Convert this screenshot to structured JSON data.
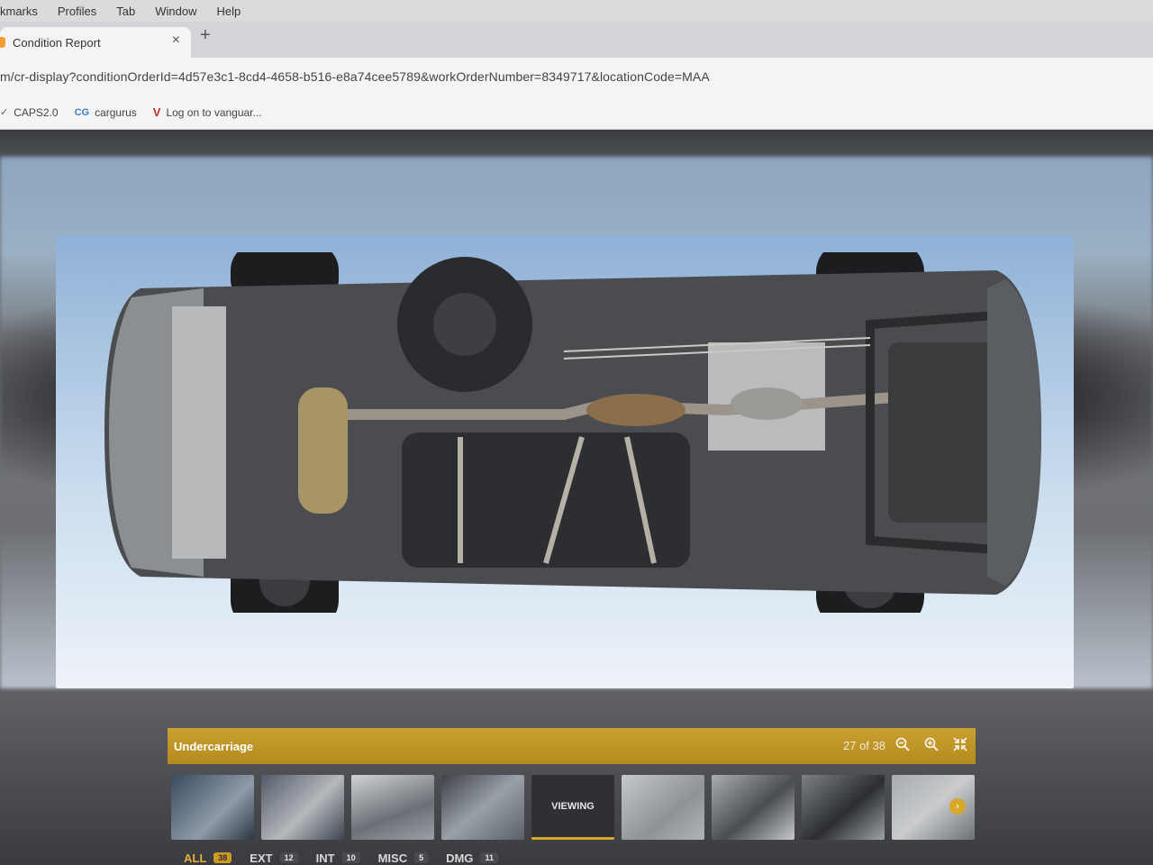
{
  "menubar": {
    "items": [
      "kmarks",
      "Profiles",
      "Tab",
      "Window",
      "Help"
    ]
  },
  "tab": {
    "title": "Condition Report",
    "close": "×",
    "new_tab": "+"
  },
  "address": {
    "url": "m/cr-display?conditionOrderId=4d57e3c1-8cd4-4658-b516-e8a74cee5789&workOrderNumber=8349717&locationCode=MAA"
  },
  "bookmarks": [
    {
      "icon": "✓",
      "label": "CAPS2.0"
    },
    {
      "icon": "CG",
      "label": "cargurus"
    },
    {
      "icon": "V",
      "label": "Log on to vanguar..."
    }
  ],
  "viewer": {
    "caption": "Undercarriage",
    "counter": "27 of 38",
    "zoom_out_icon": "zoom-out-icon",
    "zoom_in_icon": "zoom-in-icon",
    "collapse_icon": "collapse-icon"
  },
  "thumbnails": {
    "viewing_label": "VIEWING",
    "next_icon": "›"
  },
  "filters": [
    {
      "label": "ALL",
      "count": "38"
    },
    {
      "label": "EXT",
      "count": "12"
    },
    {
      "label": "INT",
      "count": "10"
    },
    {
      "label": "MISC",
      "count": "5"
    },
    {
      "label": "DMG",
      "count": "11"
    }
  ],
  "colors": {
    "accent": "#c99a25",
    "caption_bar": "#b58a1e",
    "active_filter": "#e3b13a"
  }
}
